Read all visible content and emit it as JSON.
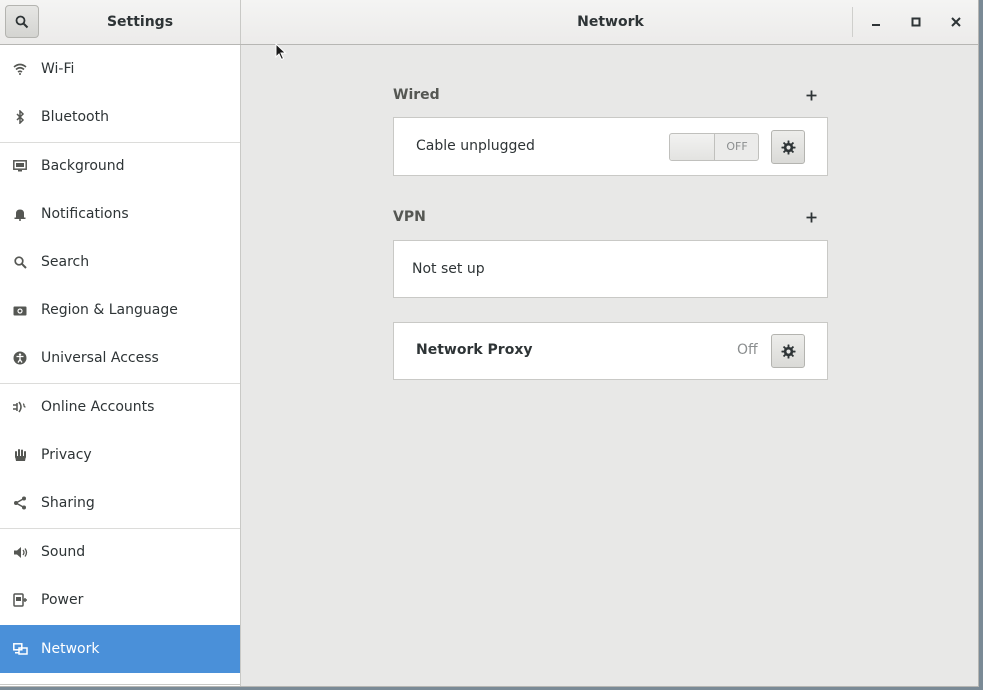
{
  "header": {
    "search_icon": "search-icon",
    "sidebar_title": "Settings",
    "page_title": "Network",
    "window_controls": [
      "minimize-icon",
      "maximize-icon",
      "close-icon"
    ]
  },
  "sidebar": {
    "items": [
      {
        "label": "Wi-Fi",
        "icon": "wifi-icon"
      },
      {
        "label": "Bluetooth",
        "icon": "bluetooth-icon"
      },
      {
        "label": "Background",
        "icon": "background-icon"
      },
      {
        "label": "Notifications",
        "icon": "bell-icon"
      },
      {
        "label": "Search",
        "icon": "search-icon"
      },
      {
        "label": "Region & Language",
        "icon": "camera-icon"
      },
      {
        "label": "Universal Access",
        "icon": "accessibility-icon"
      },
      {
        "label": "Online Accounts",
        "icon": "online-accounts-icon"
      },
      {
        "label": "Privacy",
        "icon": "hand-icon"
      },
      {
        "label": "Sharing",
        "icon": "share-icon"
      },
      {
        "label": "Sound",
        "icon": "speaker-icon"
      },
      {
        "label": "Power",
        "icon": "power-plug-icon"
      },
      {
        "label": "Network",
        "icon": "network-icon",
        "active": true
      }
    ]
  },
  "main": {
    "wired": {
      "title": "Wired",
      "status": "Cable unplugged",
      "switch_state": "OFF"
    },
    "vpn": {
      "title": "VPN",
      "status": "Not set up"
    },
    "proxy": {
      "label": "Network Proxy",
      "status": "Off"
    }
  },
  "colors": {
    "accent": "#4a90d9",
    "window_bg": "#e8e8e7",
    "sidebar_bg": "#ffffff"
  }
}
